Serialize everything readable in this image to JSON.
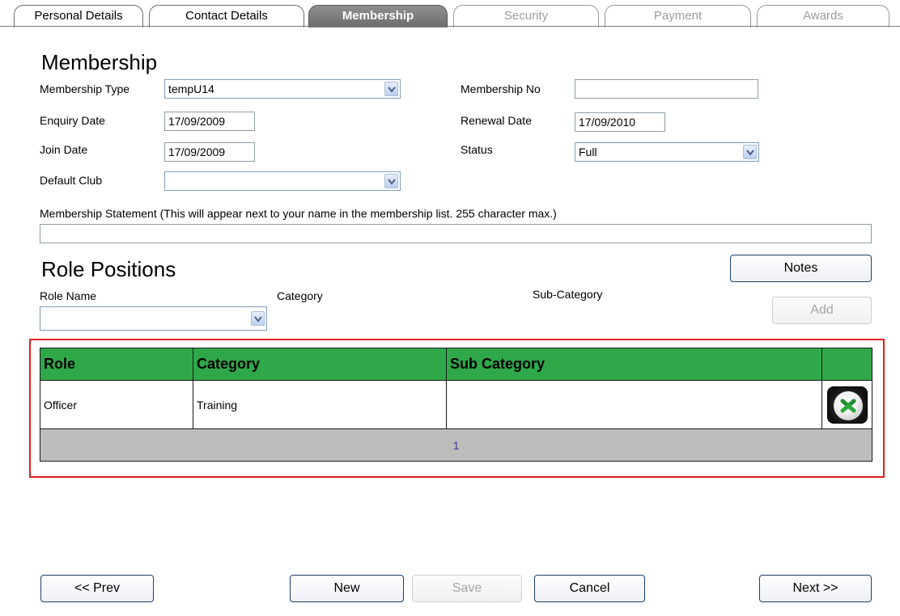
{
  "tabs": [
    {
      "label": "Personal Details",
      "state": "normal"
    },
    {
      "label": "Contact Details",
      "state": "normal"
    },
    {
      "label": "Membership",
      "state": "active"
    },
    {
      "label": "Security",
      "state": "disabled"
    },
    {
      "label": "Payment",
      "state": "disabled"
    },
    {
      "label": "Awards",
      "state": "disabled"
    }
  ],
  "membership": {
    "title": "Membership",
    "type_label": "Membership Type",
    "type_value": "tempU14",
    "enquiry_label": "Enquiry Date",
    "enquiry_value": "17/09/2009",
    "join_label": "Join Date",
    "join_value": "17/09/2009",
    "club_label": "Default Club",
    "club_value": "",
    "number_label": "Membership No",
    "number_value": "",
    "renewal_label": "Renewal Date",
    "renewal_value": "17/09/2010",
    "status_label": "Status",
    "status_value": "Full",
    "statement_label": "Membership Statement (This will appear next to your name in the membership list. 255 character max.)",
    "statement_value": ""
  },
  "roles": {
    "title": "Role Positions",
    "notes_label": "Notes",
    "role_name_label": "Role Name",
    "role_name_value": "",
    "category_label": "Category",
    "subcategory_label": "Sub-Category",
    "add_label": "Add",
    "table": {
      "headers": [
        "Role",
        "Category",
        "Sub Category",
        ""
      ],
      "rows": [
        {
          "role": "Officer",
          "category": "Training",
          "subcategory": ""
        }
      ],
      "page": "1"
    }
  },
  "footer": {
    "prev": "<< Prev",
    "new": "New",
    "save": "Save",
    "cancel": "Cancel",
    "next": "Next >>"
  },
  "colors": {
    "grid_header": "#2fa84a",
    "pager": "#bdbdbd",
    "highlight_frame": "#e02020",
    "active_tab": "#7a7a7a"
  },
  "icons": {
    "dropdown": "chevron-down-icon",
    "delete": "delete-x-icon"
  }
}
